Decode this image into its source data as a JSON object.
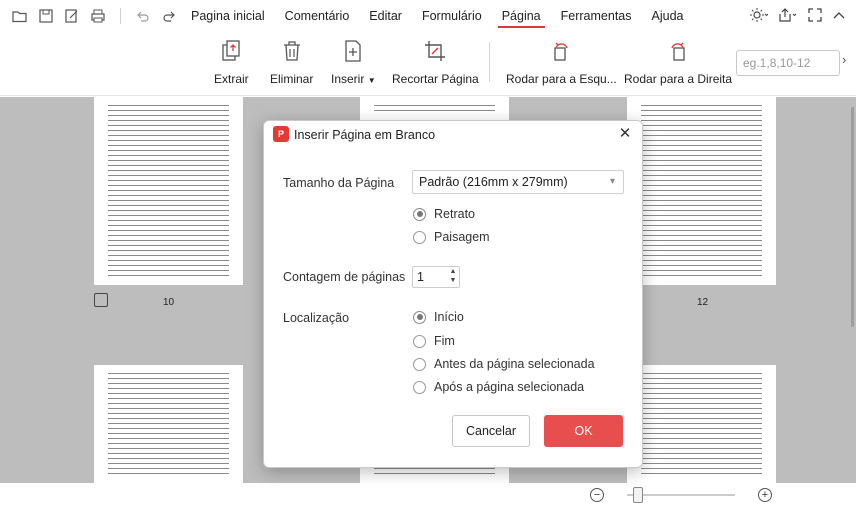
{
  "menu": {
    "items": [
      {
        "label": "Pagina inicial",
        "active": false
      },
      {
        "label": "Comentário",
        "active": false
      },
      {
        "label": "Editar",
        "active": false
      },
      {
        "label": "Formulário",
        "active": false
      },
      {
        "label": "Página",
        "active": true
      },
      {
        "label": "Ferramentas",
        "active": false
      },
      {
        "label": "Ajuda",
        "active": false
      }
    ],
    "accent_color": "#d63a3a"
  },
  "toolbar": {
    "extract_label": "Extrair",
    "delete_label": "Eliminar",
    "insert_label": "Inserir",
    "crop_label": "Recortar Página",
    "rotate_left_label": "Rodar para a Esqu...",
    "rotate_right_label": "Rodar para a Direita",
    "range_placeholder": "eg.1,8,10-12"
  },
  "pages": {
    "left_number": "10",
    "right_number": "12"
  },
  "dialog": {
    "title": "Inserir Página em Branco",
    "page_size_label": "Tamanho da Página",
    "page_size_value": "Padrão (216mm x 279mm)",
    "orientation_options": [
      "Retrato",
      "Paisagem"
    ],
    "orientation_selected": "Retrato",
    "page_count_label": "Contagem de páginas",
    "page_count_value": "1",
    "location_label": "Localização",
    "location_options": [
      "Início",
      "Fim",
      "Antes da página selecionada",
      "Após a página selecionada"
    ],
    "location_selected": "Início",
    "cancel_label": "Cancelar",
    "ok_label": "OK",
    "ok_color": "#e94e4e"
  }
}
